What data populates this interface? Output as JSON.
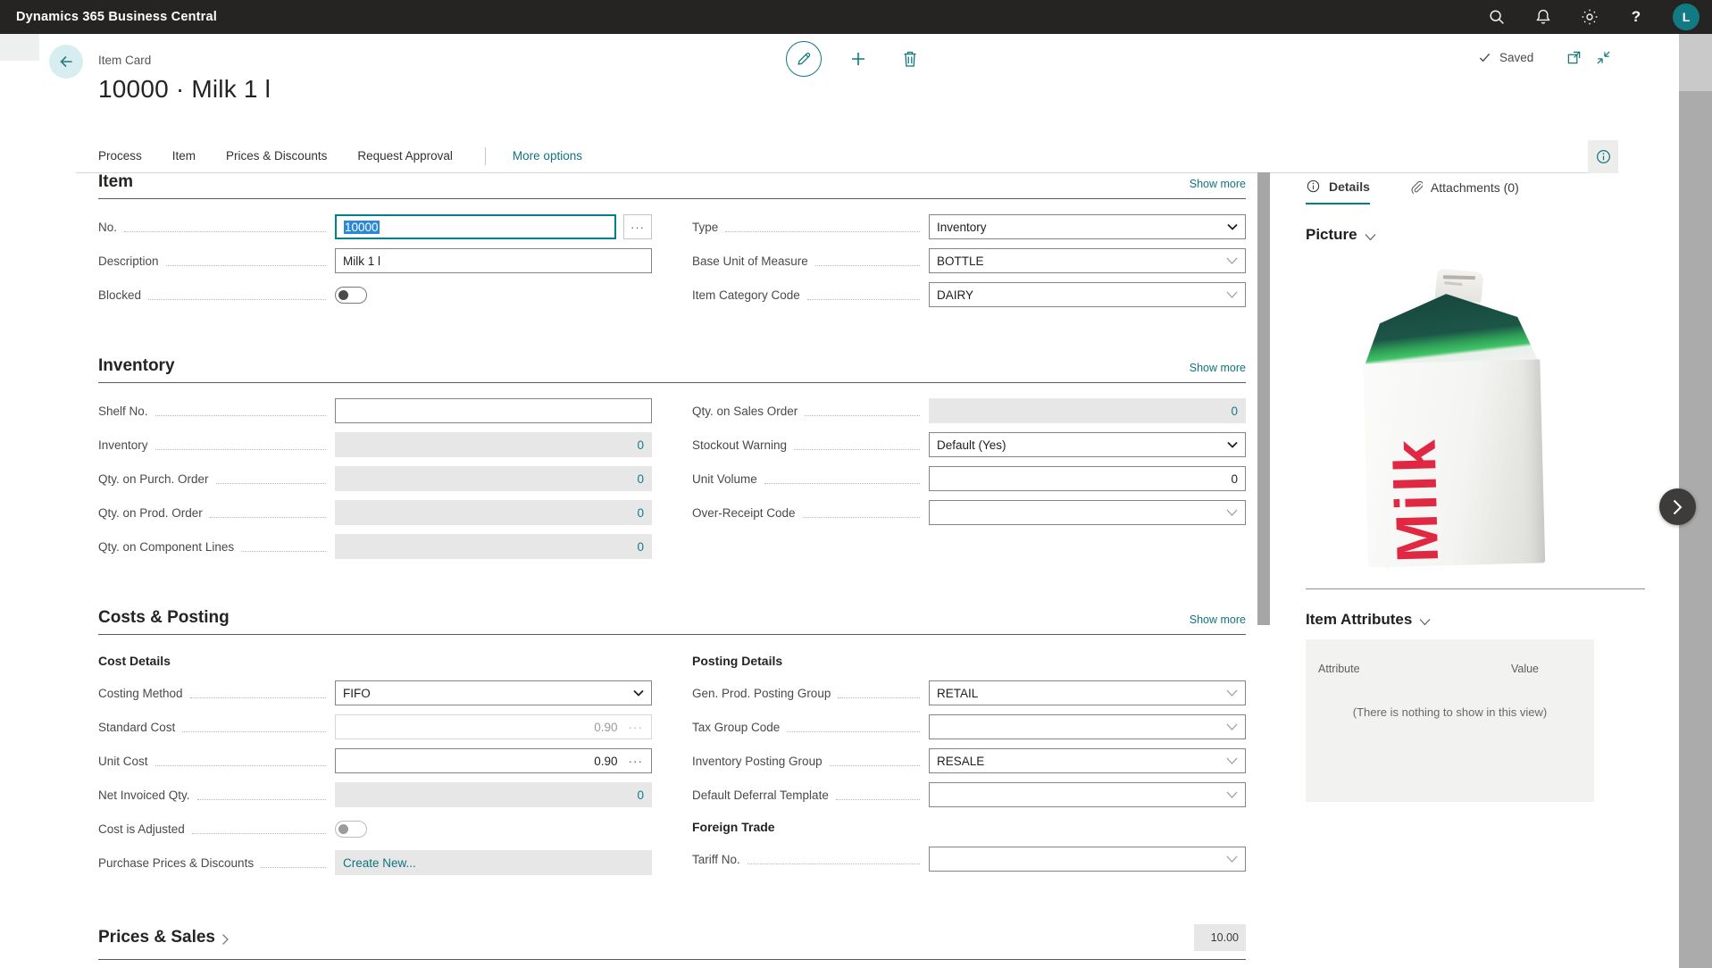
{
  "topbar": {
    "title": "Dynamics 365 Business Central",
    "avatar_initial": "L"
  },
  "header": {
    "page_type": "Item Card",
    "title": "10000 · Milk 1 l",
    "saved_label": "Saved"
  },
  "menubar": {
    "items": [
      "Process",
      "Item",
      "Prices & Discounts",
      "Request Approval"
    ],
    "more_options": "More options"
  },
  "icons": {
    "assist_edit": "···"
  },
  "item_section": {
    "title": "Item",
    "show_more": "Show more",
    "no_label": "No.",
    "no_value": "10000",
    "description_label": "Description",
    "description_value": "Milk 1 l",
    "blocked_label": "Blocked",
    "type_label": "Type",
    "type_value": "Inventory",
    "buom_label": "Base Unit of Measure",
    "buom_value": "BOTTLE",
    "category_label": "Item Category Code",
    "category_value": "DAIRY"
  },
  "inventory_section": {
    "title": "Inventory",
    "show_more": "Show more",
    "shelf_label": "Shelf No.",
    "shelf_value": "",
    "inventory_label": "Inventory",
    "inventory_value": "0",
    "qty_purch_label": "Qty. on Purch. Order",
    "qty_purch_value": "0",
    "qty_prod_label": "Qty. on Prod. Order",
    "qty_prod_value": "0",
    "qty_comp_label": "Qty. on Component Lines",
    "qty_comp_value": "0",
    "qty_sales_label": "Qty. on Sales Order",
    "qty_sales_value": "0",
    "stockout_label": "Stockout Warning",
    "stockout_value": "Default (Yes)",
    "unit_volume_label": "Unit Volume",
    "unit_volume_value": "0",
    "over_receipt_label": "Over-Receipt Code",
    "over_receipt_value": ""
  },
  "costs_section": {
    "title": "Costs & Posting",
    "show_more": "Show more",
    "cost_details_title": "Cost Details",
    "costing_method_label": "Costing Method",
    "costing_method_value": "FIFO",
    "standard_cost_label": "Standard Cost",
    "standard_cost_value": "0.90",
    "unit_cost_label": "Unit Cost",
    "unit_cost_value": "0.90",
    "net_invoiced_label": "Net Invoiced Qty.",
    "net_invoiced_value": "0",
    "cost_adjusted_label": "Cost is Adjusted",
    "purch_prices_label": "Purchase Prices & Discounts",
    "purch_prices_link": "Create New...",
    "posting_details_title": "Posting Details",
    "gen_prod_label": "Gen. Prod. Posting Group",
    "gen_prod_value": "RETAIL",
    "tax_group_label": "Tax Group Code",
    "tax_group_value": "",
    "inv_posting_label": "Inventory Posting Group",
    "inv_posting_value": "RESALE",
    "deferral_label": "Default Deferral Template",
    "deferral_value": "",
    "foreign_trade_title": "Foreign Trade",
    "tariff_label": "Tariff No.",
    "tariff_value": ""
  },
  "prices_section": {
    "title": "Prices & Sales",
    "summary_value": "10.00"
  },
  "factbox": {
    "tab_details": "Details",
    "tab_attachments": "Attachments (0)",
    "picture_title": "Picture",
    "milk_text": "Milk",
    "attributes_title": "Item Attributes",
    "attribute_col": "Attribute",
    "value_col": "Value",
    "empty_message": "(There is nothing to show in this view)"
  },
  "colors": {
    "topbar": "#252423",
    "accent": "#008089",
    "selection": "#2b88d8",
    "value_teal": "#0e7c87",
    "disabled_bg": "#e7e7e7"
  }
}
